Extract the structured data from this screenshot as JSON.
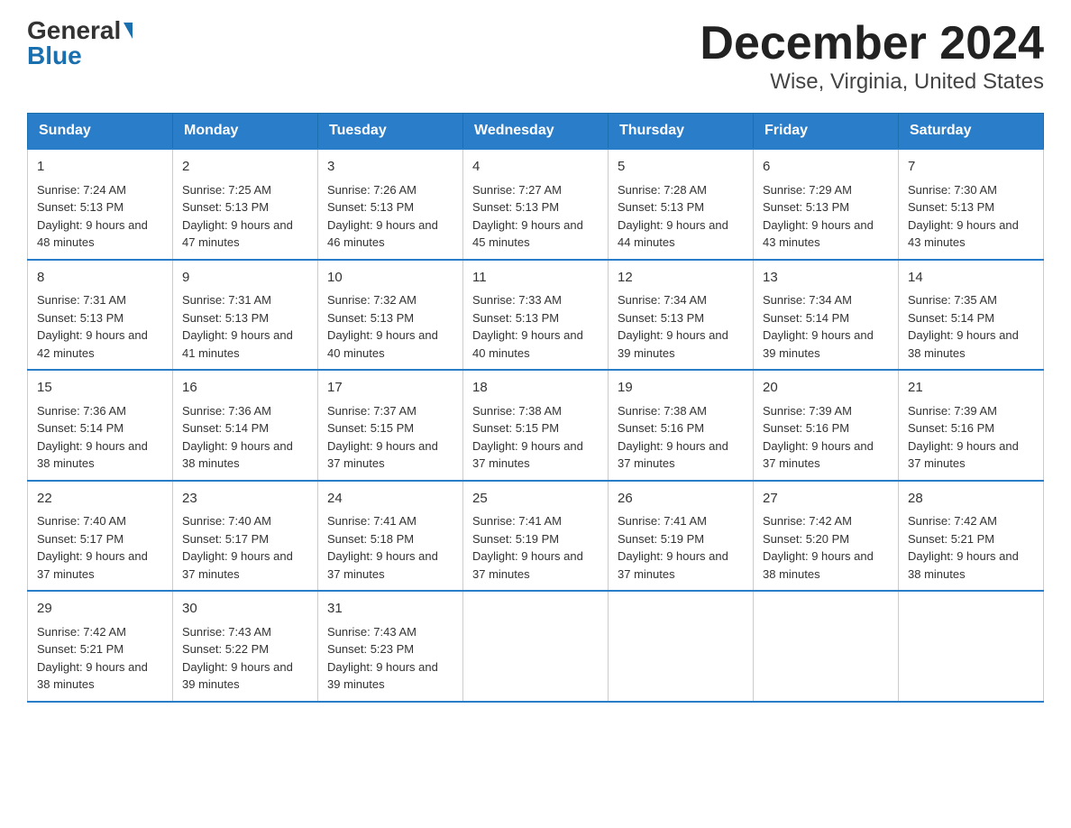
{
  "logo": {
    "general": "General",
    "blue": "Blue"
  },
  "title": "December 2024",
  "subtitle": "Wise, Virginia, United States",
  "days": [
    "Sunday",
    "Monday",
    "Tuesday",
    "Wednesday",
    "Thursday",
    "Friday",
    "Saturday"
  ],
  "weeks": [
    [
      {
        "num": "1",
        "sunrise": "7:24 AM",
        "sunset": "5:13 PM",
        "daylight": "9 hours and 48 minutes."
      },
      {
        "num": "2",
        "sunrise": "7:25 AM",
        "sunset": "5:13 PM",
        "daylight": "9 hours and 47 minutes."
      },
      {
        "num": "3",
        "sunrise": "7:26 AM",
        "sunset": "5:13 PM",
        "daylight": "9 hours and 46 minutes."
      },
      {
        "num": "4",
        "sunrise": "7:27 AM",
        "sunset": "5:13 PM",
        "daylight": "9 hours and 45 minutes."
      },
      {
        "num": "5",
        "sunrise": "7:28 AM",
        "sunset": "5:13 PM",
        "daylight": "9 hours and 44 minutes."
      },
      {
        "num": "6",
        "sunrise": "7:29 AM",
        "sunset": "5:13 PM",
        "daylight": "9 hours and 43 minutes."
      },
      {
        "num": "7",
        "sunrise": "7:30 AM",
        "sunset": "5:13 PM",
        "daylight": "9 hours and 43 minutes."
      }
    ],
    [
      {
        "num": "8",
        "sunrise": "7:31 AM",
        "sunset": "5:13 PM",
        "daylight": "9 hours and 42 minutes."
      },
      {
        "num": "9",
        "sunrise": "7:31 AM",
        "sunset": "5:13 PM",
        "daylight": "9 hours and 41 minutes."
      },
      {
        "num": "10",
        "sunrise": "7:32 AM",
        "sunset": "5:13 PM",
        "daylight": "9 hours and 40 minutes."
      },
      {
        "num": "11",
        "sunrise": "7:33 AM",
        "sunset": "5:13 PM",
        "daylight": "9 hours and 40 minutes."
      },
      {
        "num": "12",
        "sunrise": "7:34 AM",
        "sunset": "5:13 PM",
        "daylight": "9 hours and 39 minutes."
      },
      {
        "num": "13",
        "sunrise": "7:34 AM",
        "sunset": "5:14 PM",
        "daylight": "9 hours and 39 minutes."
      },
      {
        "num": "14",
        "sunrise": "7:35 AM",
        "sunset": "5:14 PM",
        "daylight": "9 hours and 38 minutes."
      }
    ],
    [
      {
        "num": "15",
        "sunrise": "7:36 AM",
        "sunset": "5:14 PM",
        "daylight": "9 hours and 38 minutes."
      },
      {
        "num": "16",
        "sunrise": "7:36 AM",
        "sunset": "5:14 PM",
        "daylight": "9 hours and 38 minutes."
      },
      {
        "num": "17",
        "sunrise": "7:37 AM",
        "sunset": "5:15 PM",
        "daylight": "9 hours and 37 minutes."
      },
      {
        "num": "18",
        "sunrise": "7:38 AM",
        "sunset": "5:15 PM",
        "daylight": "9 hours and 37 minutes."
      },
      {
        "num": "19",
        "sunrise": "7:38 AM",
        "sunset": "5:16 PM",
        "daylight": "9 hours and 37 minutes."
      },
      {
        "num": "20",
        "sunrise": "7:39 AM",
        "sunset": "5:16 PM",
        "daylight": "9 hours and 37 minutes."
      },
      {
        "num": "21",
        "sunrise": "7:39 AM",
        "sunset": "5:16 PM",
        "daylight": "9 hours and 37 minutes."
      }
    ],
    [
      {
        "num": "22",
        "sunrise": "7:40 AM",
        "sunset": "5:17 PM",
        "daylight": "9 hours and 37 minutes."
      },
      {
        "num": "23",
        "sunrise": "7:40 AM",
        "sunset": "5:17 PM",
        "daylight": "9 hours and 37 minutes."
      },
      {
        "num": "24",
        "sunrise": "7:41 AM",
        "sunset": "5:18 PM",
        "daylight": "9 hours and 37 minutes."
      },
      {
        "num": "25",
        "sunrise": "7:41 AM",
        "sunset": "5:19 PM",
        "daylight": "9 hours and 37 minutes."
      },
      {
        "num": "26",
        "sunrise": "7:41 AM",
        "sunset": "5:19 PM",
        "daylight": "9 hours and 37 minutes."
      },
      {
        "num": "27",
        "sunrise": "7:42 AM",
        "sunset": "5:20 PM",
        "daylight": "9 hours and 38 minutes."
      },
      {
        "num": "28",
        "sunrise": "7:42 AM",
        "sunset": "5:21 PM",
        "daylight": "9 hours and 38 minutes."
      }
    ],
    [
      {
        "num": "29",
        "sunrise": "7:42 AM",
        "sunset": "5:21 PM",
        "daylight": "9 hours and 38 minutes."
      },
      {
        "num": "30",
        "sunrise": "7:43 AM",
        "sunset": "5:22 PM",
        "daylight": "9 hours and 39 minutes."
      },
      {
        "num": "31",
        "sunrise": "7:43 AM",
        "sunset": "5:23 PM",
        "daylight": "9 hours and 39 minutes."
      },
      null,
      null,
      null,
      null
    ]
  ]
}
